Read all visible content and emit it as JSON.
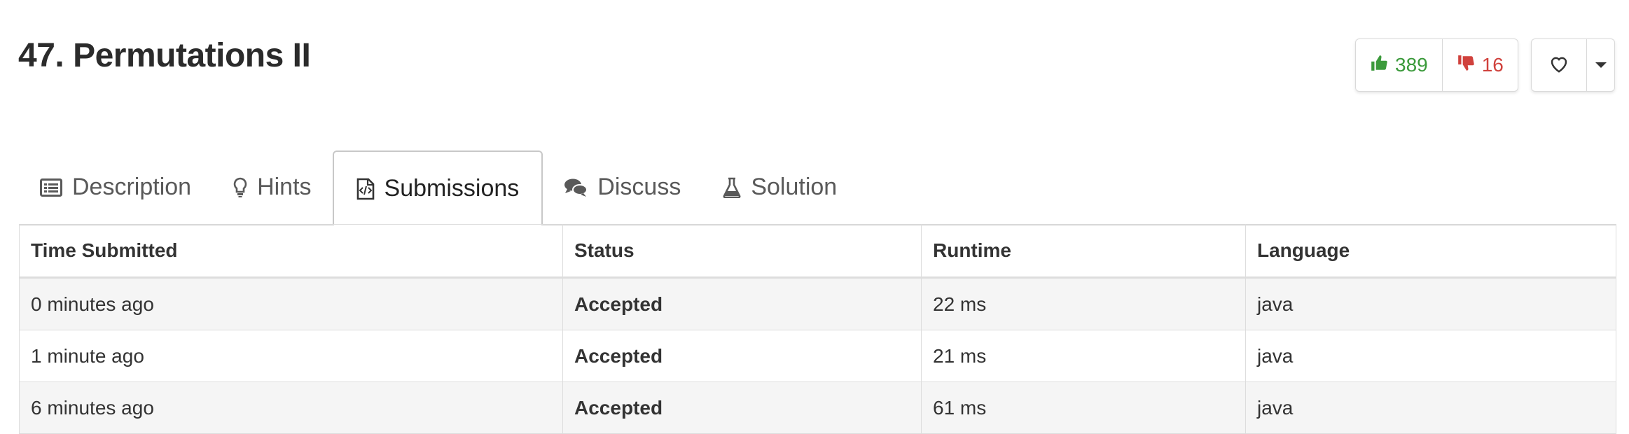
{
  "problem": {
    "title": "47. Permutations II",
    "likes": "389",
    "dislikes": "16"
  },
  "tabs": [
    {
      "label": "Description",
      "icon": "list-icon",
      "active": false
    },
    {
      "label": "Hints",
      "icon": "lightbulb-icon",
      "active": false
    },
    {
      "label": "Submissions",
      "icon": "code-file-icon",
      "active": true
    },
    {
      "label": "Discuss",
      "icon": "comments-icon",
      "active": false
    },
    {
      "label": "Solution",
      "icon": "flask-icon",
      "active": false
    }
  ],
  "table": {
    "headers": [
      "Time Submitted",
      "Status",
      "Runtime",
      "Language"
    ],
    "rows": [
      {
        "time": "0 minutes ago",
        "status": "Accepted",
        "runtime": "22 ms",
        "language": "java"
      },
      {
        "time": "1 minute ago",
        "status": "Accepted",
        "runtime": "21 ms",
        "language": "java"
      },
      {
        "time": "6 minutes ago",
        "status": "Accepted",
        "runtime": "61 ms",
        "language": "java"
      }
    ]
  },
  "colors": {
    "accepted": "#3b9a3b",
    "like": "#3b9a3b",
    "dislike": "#d0413c"
  }
}
